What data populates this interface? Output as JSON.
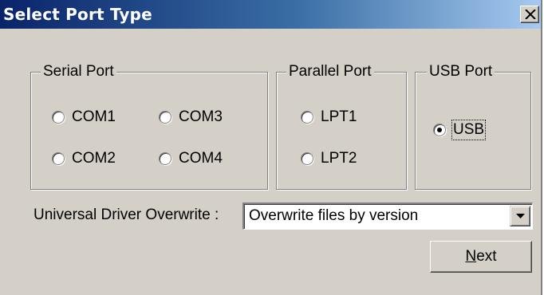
{
  "window": {
    "title": "Select Port Type",
    "close_glyph": "X"
  },
  "serial_port": {
    "label": "Serial Port",
    "options": [
      {
        "label": "COM1",
        "selected": false
      },
      {
        "label": "COM3",
        "selected": false
      },
      {
        "label": "COM2",
        "selected": false
      },
      {
        "label": "COM4",
        "selected": false
      }
    ]
  },
  "parallel_port": {
    "label": "Parallel Port",
    "options": [
      {
        "label": "LPT1",
        "selected": false
      },
      {
        "label": "LPT2",
        "selected": false
      }
    ]
  },
  "usb_port": {
    "label": "USB Port",
    "options": [
      {
        "label": "USB",
        "selected": true
      }
    ]
  },
  "driver_overwrite": {
    "label": "Universal Driver Overwrite :",
    "selected_value": "Overwrite files by version",
    "arrow_icon": "chevron-down-icon"
  },
  "buttons": {
    "next_mnemonic": "N",
    "next_rest": "ext"
  },
  "colors": {
    "face": "#d4d0c8",
    "title_start": "#0a246a",
    "title_end": "#a6caf0"
  }
}
